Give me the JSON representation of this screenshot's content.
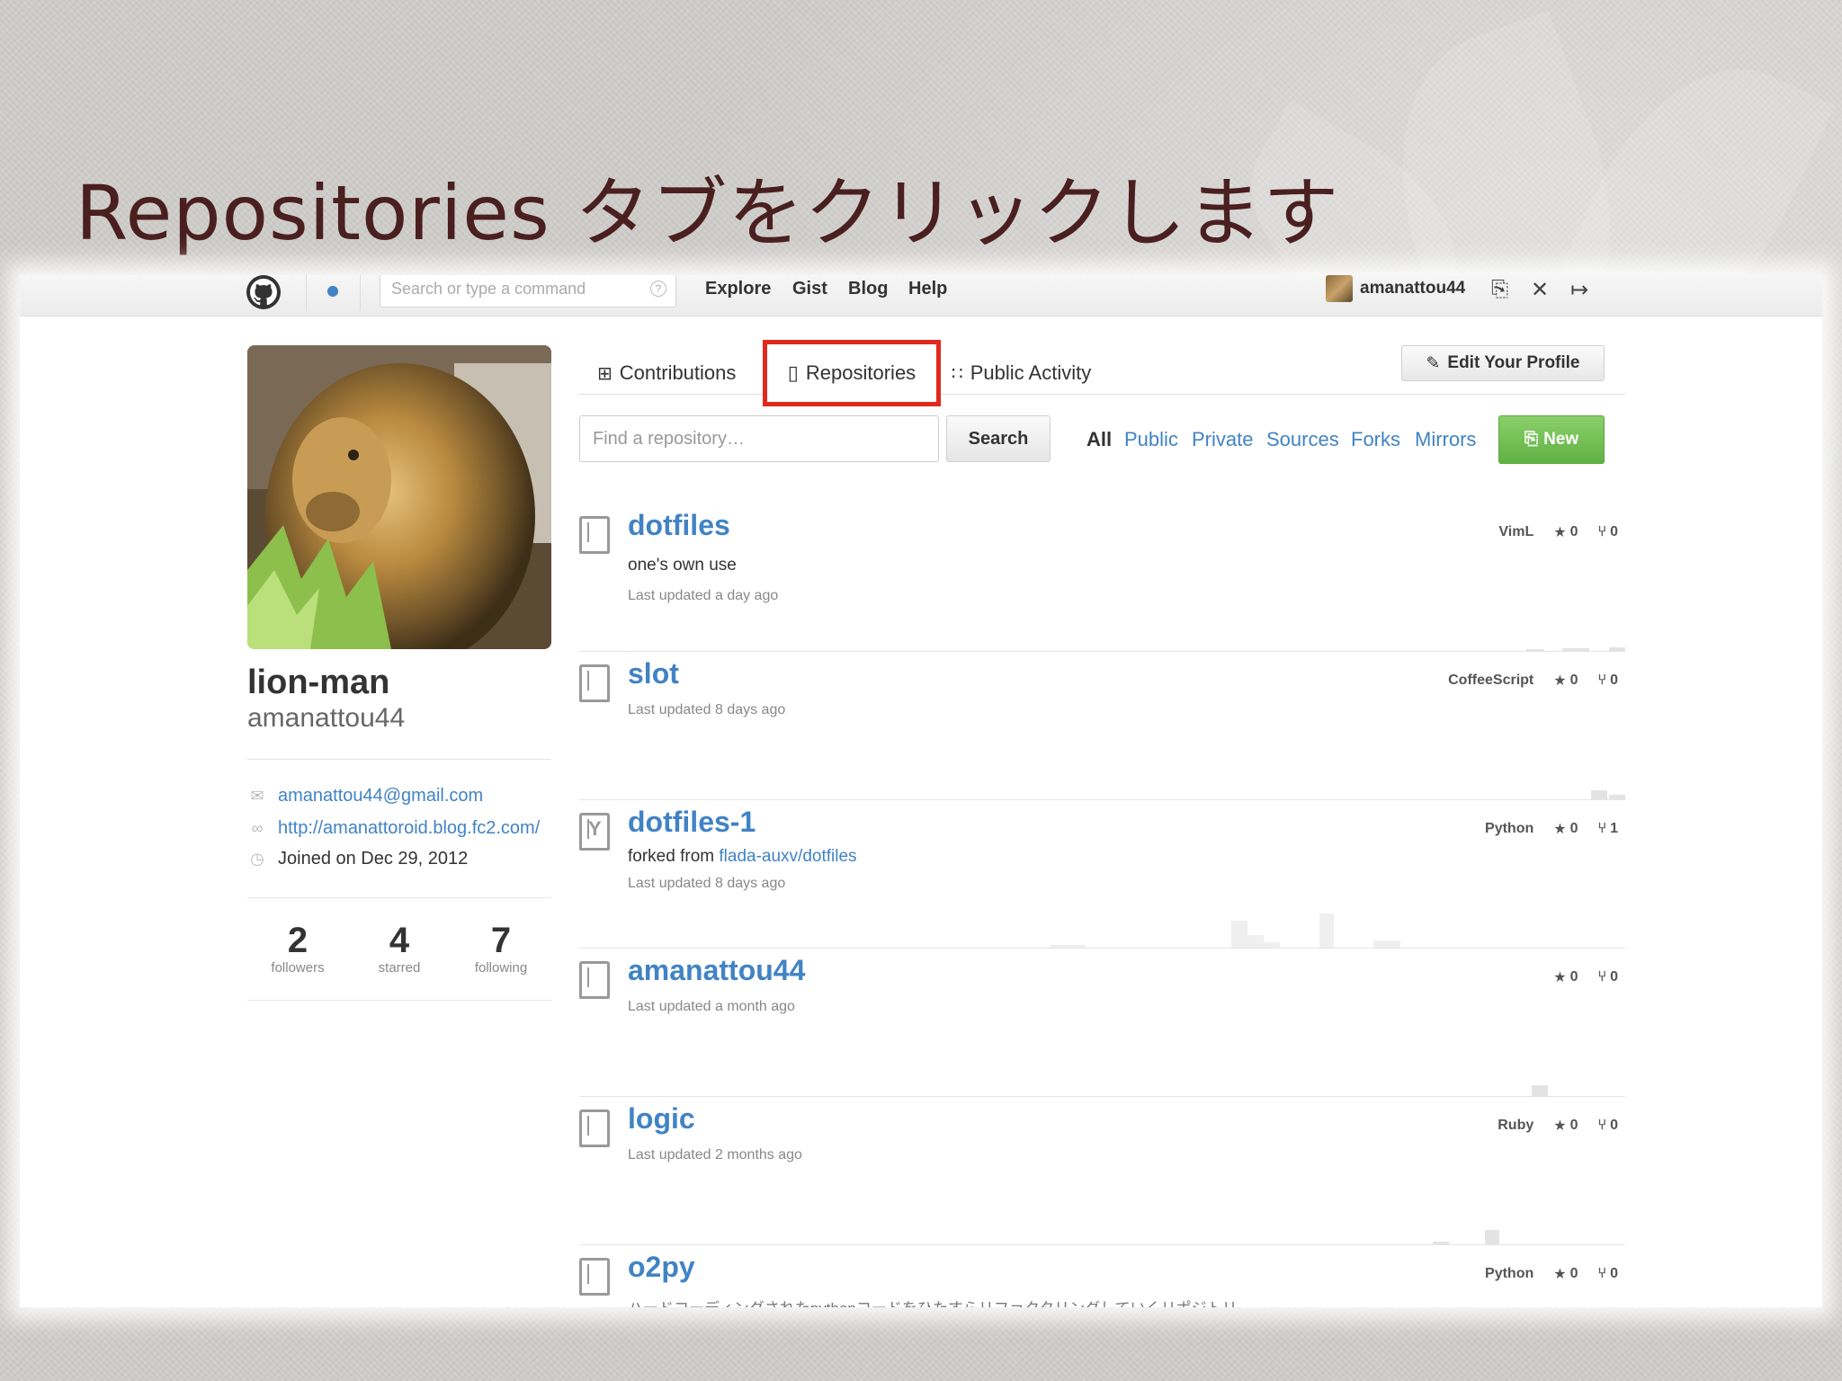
{
  "slide": {
    "title": "Repositories タブをクリックします"
  },
  "header": {
    "search_placeholder": "Search or type a command",
    "help": "?",
    "nav": [
      "Explore",
      "Gist",
      "Blog",
      "Help"
    ],
    "username": "amanattou44"
  },
  "profile": {
    "fullname": "lion-man",
    "login": "amanattou44",
    "email": "amanattou44@gmail.com",
    "url": "http://amanattoroid.blog.fc2.com/",
    "joined": "Joined on Dec 29, 2012",
    "stats": [
      {
        "num": "2",
        "label": "followers"
      },
      {
        "num": "4",
        "label": "starred"
      },
      {
        "num": "7",
        "label": "following"
      }
    ]
  },
  "tabs": {
    "contributions": "Contributions",
    "repositories": "Repositories",
    "public_activity": "Public Activity",
    "edit_profile": "Edit Your Profile"
  },
  "filter": {
    "placeholder": "Find a repository…",
    "search_label": "Search",
    "options": [
      "All",
      "Public",
      "Private",
      "Sources",
      "Forks",
      "Mirrors"
    ],
    "active": "All",
    "new_label": "New"
  },
  "repos": [
    {
      "name": "dotfiles",
      "description": "one's own use",
      "updated": "Last updated a day ago",
      "language": "VimL",
      "stars": "0",
      "forks": "0",
      "fork": false
    },
    {
      "name": "slot",
      "description": "",
      "updated": "Last updated 8 days ago",
      "language": "CoffeeScript",
      "stars": "0",
      "forks": "0",
      "fork": false
    },
    {
      "name": "dotfiles-1",
      "forked_prefix": "forked from ",
      "forked_from": "flada-auxv/dotfiles",
      "updated": "Last updated 8 days ago",
      "language": "Python",
      "stars": "0",
      "forks": "1",
      "fork": true
    },
    {
      "name": "amanattou44",
      "description": "",
      "updated": "Last updated a month ago",
      "language": "",
      "stars": "0",
      "forks": "0",
      "fork": false
    },
    {
      "name": "logic",
      "description": "",
      "updated": "Last updated 2 months ago",
      "language": "Ruby",
      "stars": "0",
      "forks": "0",
      "fork": false
    },
    {
      "name": "o2py",
      "description": "ハードコーディングされたpythonコードをひたすらリファクタリングしていくリポジトリ",
      "updated": "",
      "language": "Python",
      "stars": "0",
      "forks": "0",
      "fork": false
    }
  ],
  "colors": {
    "link": "#4183c4",
    "highlight": "#e0291d",
    "new_button": "#60b044",
    "title": "#4a1f1f"
  },
  "icons": [
    "octocat-icon",
    "notification-dot-icon",
    "create-repo-icon",
    "settings-icon",
    "sign-out-icon",
    "mail-icon",
    "link-icon",
    "clock-icon",
    "contributions-icon",
    "repo-icon",
    "rss-icon",
    "pencil-icon",
    "star-icon",
    "fork-icon"
  ]
}
